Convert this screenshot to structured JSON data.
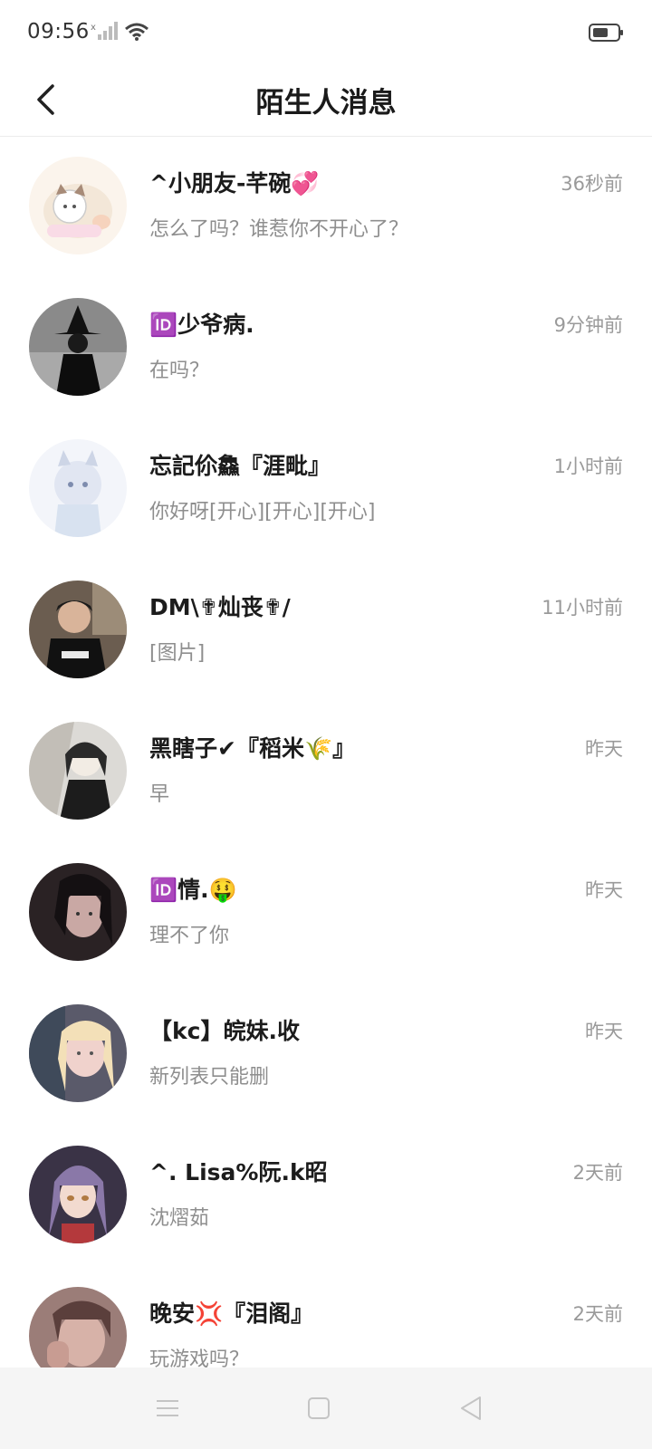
{
  "status": {
    "time": "09:56"
  },
  "header": {
    "title": "陌生人消息"
  },
  "colors": {
    "background": "#ffffff",
    "name": "#1c1c1c",
    "meta": "#9a9a9a",
    "navbar": "#f5f5f5"
  },
  "messages": [
    {
      "name": "^小朋友-芊碗💞",
      "time": "36秒前",
      "preview": "怎么了吗？谁惹你不开心了？",
      "avatar": "cartoon-cat"
    },
    {
      "name": "🆔少爷病.",
      "time": "9分钟前",
      "preview": "在吗？",
      "avatar": "witch-silhouette"
    },
    {
      "name": "忘記伱鱻『涯毗』",
      "time": "1小时前",
      "preview": "你好呀[开心][开心][开心]",
      "avatar": "anime-girl"
    },
    {
      "name": "DM\\✟灿丧✟/",
      "time": "11小时前",
      "preview": "[图片]",
      "avatar": "man-photo"
    },
    {
      "name": "黑瞎子✔『稻米🌾』",
      "time": "昨天",
      "preview": "早",
      "avatar": "anime-sketch"
    },
    {
      "name": "🆔情.🤑",
      "time": "昨天",
      "preview": "理不了你",
      "avatar": "girl-dark"
    },
    {
      "name": "【kc】皖妹.收",
      "time": "昨天",
      "preview": "新列表只能删",
      "avatar": "blonde-girl"
    },
    {
      "name": "^. Lisa%阮.k昭",
      "time": "2天前",
      "preview": "沈熠茹",
      "avatar": "anime-purple"
    },
    {
      "name": "晚安💢『泪阁』",
      "time": "2天前",
      "preview": "玩游戏吗？",
      "avatar": "girl-photo"
    }
  ]
}
